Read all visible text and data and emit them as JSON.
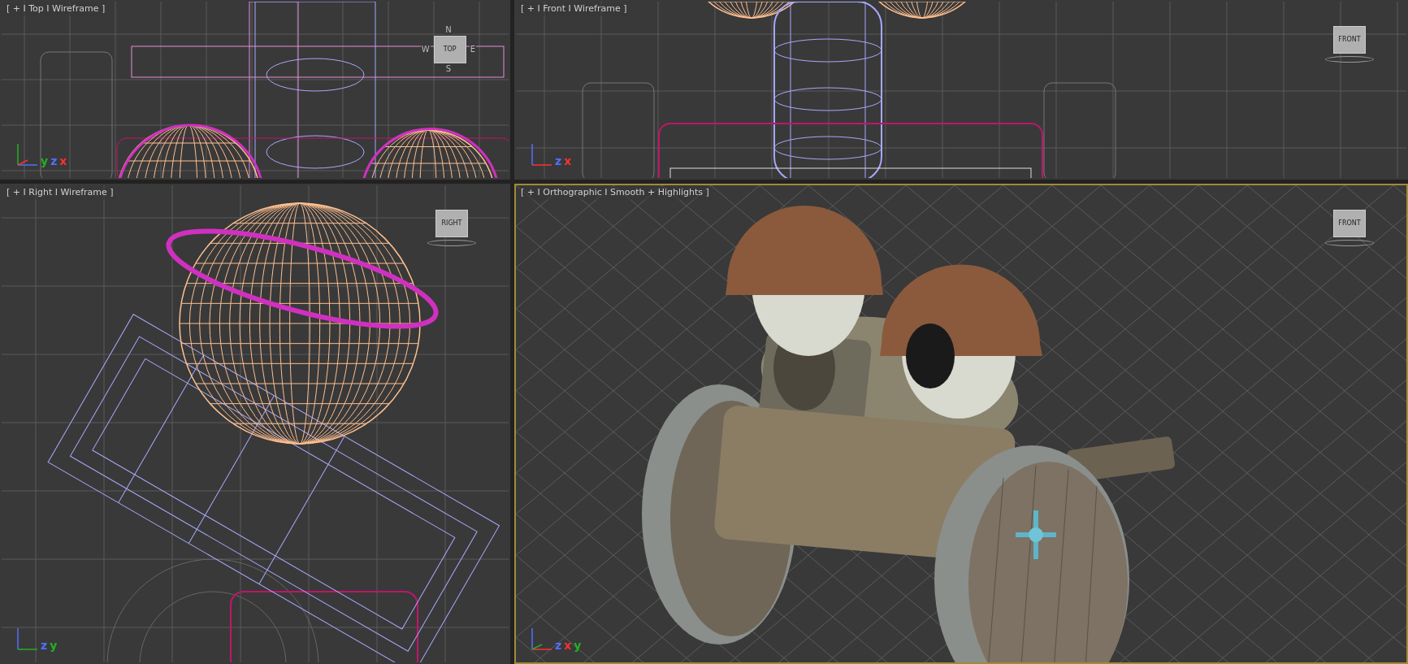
{
  "viewports": [
    {
      "kind": "top",
      "label": "[ + I Top I Wireframe ]",
      "active": false,
      "viewcube": {
        "label": "TOP",
        "compass": [
          "N",
          "W",
          "E",
          "S"
        ]
      },
      "axes": [
        {
          "letter": "y",
          "color": "#22b022"
        },
        {
          "letter": "z",
          "color": "#5070ff"
        },
        {
          "letter": "x",
          "color": "#ff3030"
        }
      ]
    },
    {
      "kind": "front",
      "label": "[ + I Front I Wireframe ]",
      "active": false,
      "viewcube": {
        "label": "FRONT"
      },
      "axes": [
        {
          "letter": "z",
          "color": "#5070ff"
        },
        {
          "letter": "x",
          "color": "#ff3030"
        }
      ]
    },
    {
      "kind": "right",
      "label": "[ + I Right I Wireframe ]",
      "active": false,
      "viewcube": {
        "label": "RIGHT"
      },
      "axes": [
        {
          "letter": "z",
          "color": "#5070ff"
        },
        {
          "letter": "y",
          "color": "#22b022"
        }
      ]
    },
    {
      "kind": "orthographic",
      "label": "[ + I Orthographic I Smooth + Highlights ]",
      "active": true,
      "viewcube": {
        "label": "FRONT"
      },
      "axes": [
        {
          "letter": "z",
          "color": "#5070ff"
        },
        {
          "letter": "x",
          "color": "#ff3030"
        },
        {
          "letter": "y",
          "color": "#22b022"
        }
      ]
    }
  ]
}
